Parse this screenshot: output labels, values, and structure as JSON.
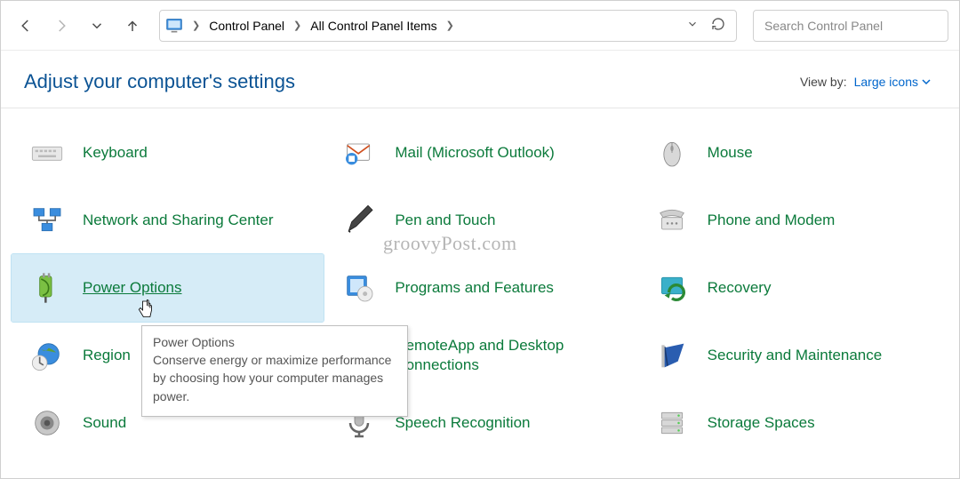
{
  "toolbar": {
    "breadcrumb": [
      "Control Panel",
      "All Control Panel Items"
    ],
    "search_placeholder": "Search Control Panel"
  },
  "header": {
    "title": "Adjust your computer's settings",
    "view_by_label": "View by:",
    "view_by_value": "Large icons"
  },
  "items": [
    {
      "label": "Keyboard",
      "icon": "keyboard-icon"
    },
    {
      "label": "Mail (Microsoft Outlook)",
      "icon": "mail-icon"
    },
    {
      "label": "Mouse",
      "icon": "mouse-icon"
    },
    {
      "label": "Network and Sharing Center",
      "icon": "network-icon"
    },
    {
      "label": "Pen and Touch",
      "icon": "pen-icon"
    },
    {
      "label": "Phone and Modem",
      "icon": "phone-icon"
    },
    {
      "label": "Power Options",
      "icon": "power-icon",
      "selected": true
    },
    {
      "label": "Programs and Features",
      "icon": "programs-icon"
    },
    {
      "label": "Recovery",
      "icon": "recovery-icon"
    },
    {
      "label": "Region",
      "icon": "region-icon"
    },
    {
      "label": "RemoteApp and Desktop Connections",
      "icon": "remoteapp-icon"
    },
    {
      "label": "Security and Maintenance",
      "icon": "security-icon"
    },
    {
      "label": "Sound",
      "icon": "sound-icon"
    },
    {
      "label": "Speech Recognition",
      "icon": "speech-icon"
    },
    {
      "label": "Storage Spaces",
      "icon": "storage-icon"
    }
  ],
  "tooltip": {
    "title": "Power Options",
    "body": "Conserve energy or maximize performance by choosing how your computer manages power."
  },
  "watermark": "groovyPost.com"
}
